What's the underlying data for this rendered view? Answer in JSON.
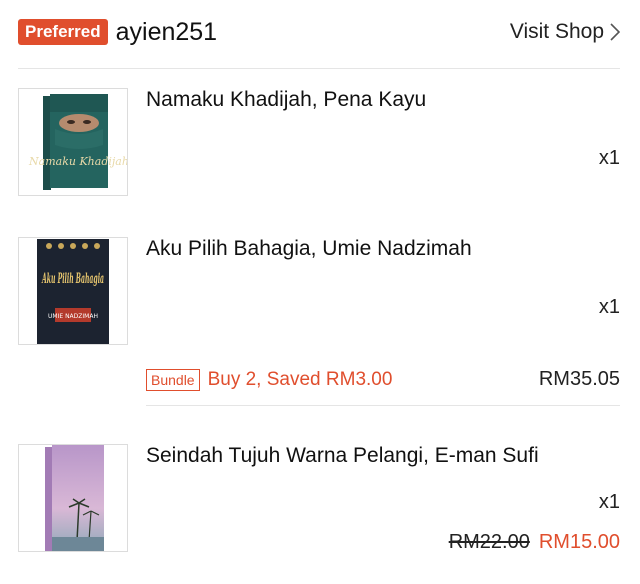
{
  "shop": {
    "badge": "Preferred",
    "name": "ayien251",
    "visit_label": "Visit Shop"
  },
  "items": [
    {
      "title": "Namaku Khadijah, Pena Kayu",
      "qty": "x1",
      "cover_text": "Namaku Khadijah"
    },
    {
      "title": "Aku Pilih Bahagia, Umie Nadzimah",
      "qty": "x1",
      "cover_text": "Aku Pilih Bahagia",
      "cover_author": "UMIE NADZIMAH"
    },
    {
      "title": "Seindah Tujuh Warna Pelangi, E-man Sufi",
      "qty": "x1",
      "old_price": "RM22.00",
      "price": "RM15.00"
    }
  ],
  "bundle": {
    "tag": "Bundle",
    "text": "Buy 2, Saved RM3.00",
    "price": "RM35.05"
  },
  "colors": {
    "accent": "#e04e2d",
    "divider": "#e5e5e5"
  },
  "icons": {
    "visit_shop": "chevron-right-icon"
  }
}
